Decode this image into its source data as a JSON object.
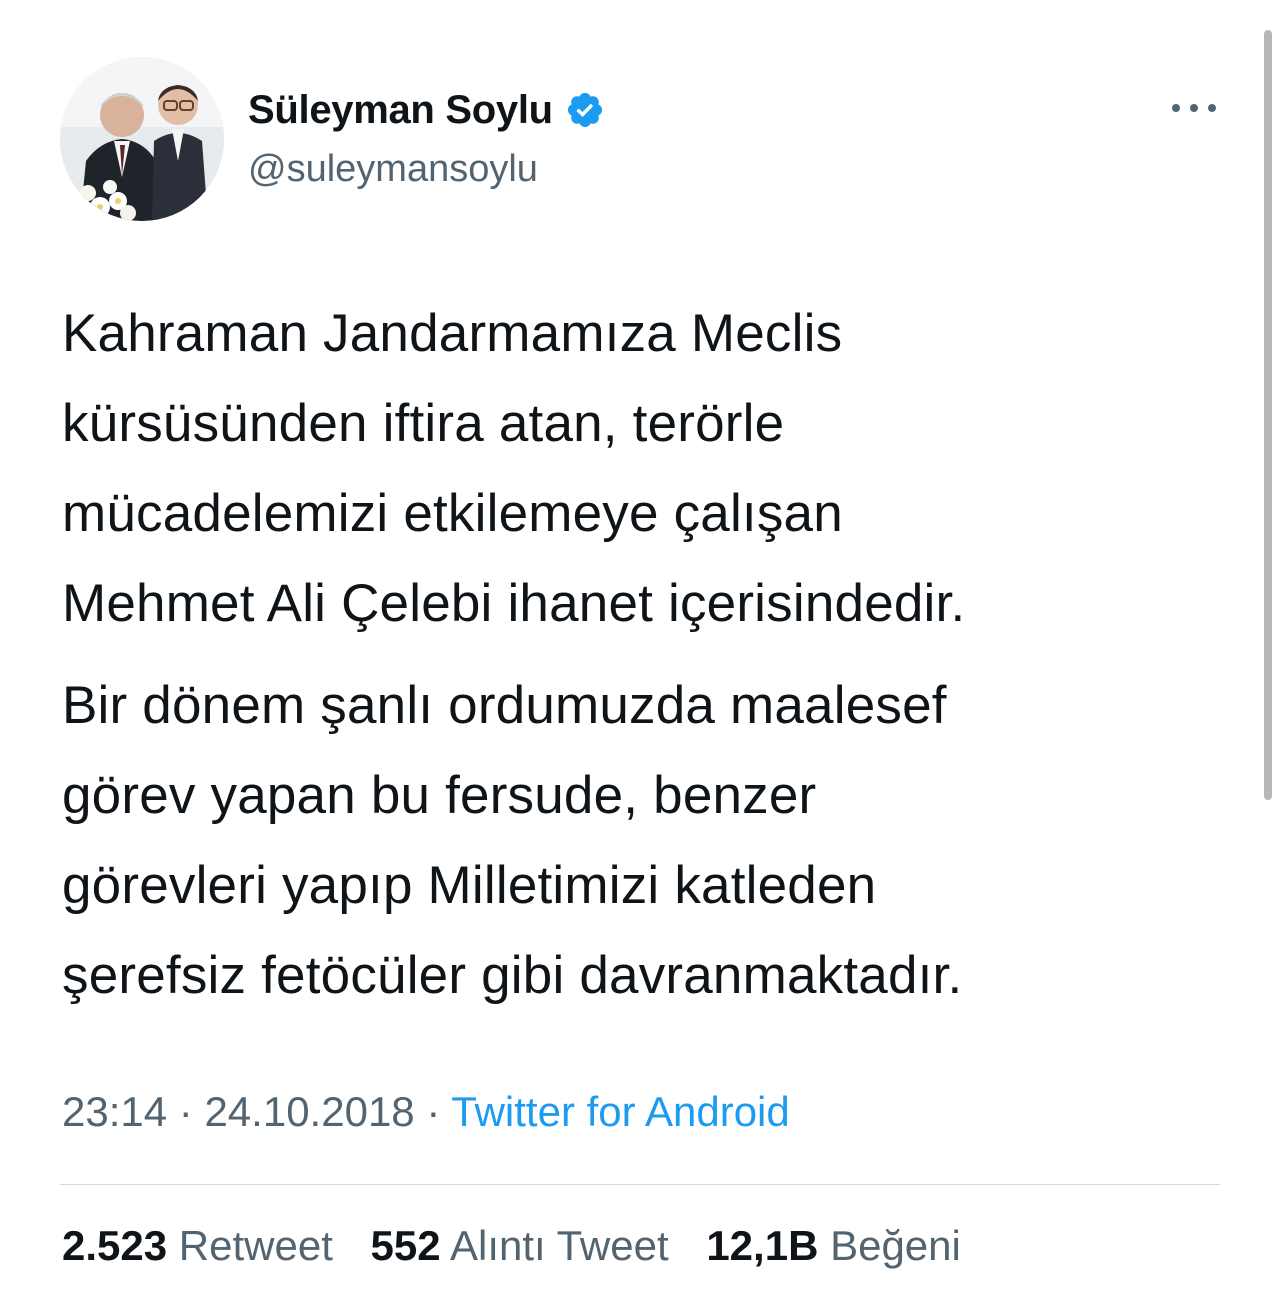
{
  "user": {
    "display_name": "Süleyman Soylu",
    "handle": "@suleymansoylu",
    "verified": true
  },
  "tweet": {
    "paragraphs": [
      {
        "lines": [
          "Kahraman Jandarmamıza Meclis",
          "kürsüsünden iftira atan, terörle",
          "mücadelemizi etkilemeye çalışan",
          "Mehmet Ali Çelebi ihanet içerisindedir."
        ]
      },
      {
        "lines": [
          "Bir dönem şanlı ordumuzda maalesef",
          "görev yapan bu fersude, benzer",
          "görevleri yapıp Milletimizi katleden",
          "şerefsiz fetöcüler gibi davranmaktadır."
        ]
      }
    ],
    "time": "23:14",
    "separator": "·",
    "date": "24.10.2018",
    "source": "Twitter for Android"
  },
  "stats": {
    "retweets": {
      "count": "2.523",
      "label": "Retweet"
    },
    "quotes": {
      "count": "552",
      "label": "Alıntı Tweet"
    },
    "likes": {
      "count": "12,1B",
      "label": "Beğeni"
    }
  },
  "icons": {
    "verified": "verified-badge-icon",
    "more": "more-options-icon"
  },
  "colors": {
    "text": "#0f1419",
    "secondary": "#536471",
    "accent": "#1d9bf0"
  }
}
